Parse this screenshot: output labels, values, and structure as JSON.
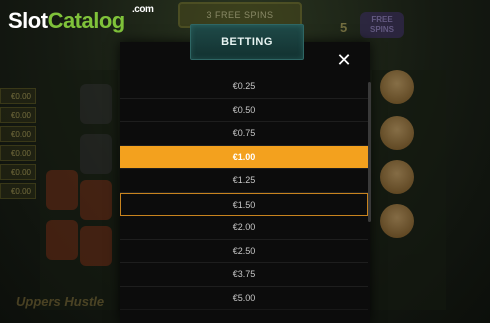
{
  "watermark": {
    "slot": "Slot",
    "catalog": "Catalog",
    "com": ".com"
  },
  "background": {
    "banner_text": "3 FREE SPINS",
    "side_number": "5",
    "free_badge": "FREE SPINS",
    "left_bets": [
      "€0.00",
      "€0.00",
      "€0.00",
      "€0.00",
      "€0.00",
      "€0.00"
    ],
    "bottom_text": "Uppers Hustle"
  },
  "modal": {
    "title": "BETTING",
    "close_symbol": "✕",
    "options": [
      "€0.25",
      "€0.50",
      "€0.75",
      "€1.00",
      "€1.25",
      "€1.50",
      "€2.00",
      "€2.50",
      "€3.75",
      "€5.00"
    ],
    "selected_value": "€1.00",
    "highlighted_value": "€1.50"
  },
  "colors": {
    "selected": "#f3a11e",
    "highlight_border": "#c8831e",
    "title_tab": "#1f4a48",
    "logo_green": "#7fc23a"
  }
}
